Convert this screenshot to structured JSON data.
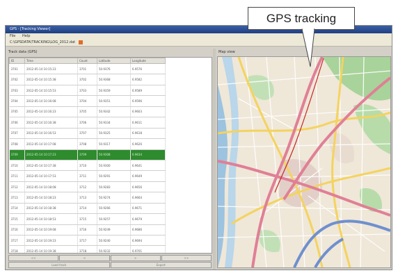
{
  "window": {
    "title": "GPS - [Tracking Viewer]"
  },
  "menu": {
    "items": [
      "File",
      "Help"
    ]
  },
  "path": {
    "text": "C:\\GPSDATA\\TRACKING\\LOG_2012.dat"
  },
  "left_panel": {
    "title": "Track data (GPS)"
  },
  "table": {
    "columns": [
      "ID",
      "Time",
      "Count",
      "Latitude",
      "Longitude"
    ],
    "rows": [
      [
        "3701",
        "2012-05-14 10:15:23",
        "3701",
        "50.9376",
        "6.9576"
      ],
      [
        "3702",
        "2012-05-14 10:15:38",
        "3702",
        "50.9368",
        "6.9582"
      ],
      [
        "3703",
        "2012-05-14 10:15:53",
        "3703",
        "50.9359",
        "6.9589"
      ],
      [
        "3704",
        "2012-05-14 10:16:08",
        "3704",
        "50.9351",
        "6.9596"
      ],
      [
        "3705",
        "2012-05-14 10:16:23",
        "3705",
        "50.9342",
        "6.9603"
      ],
      [
        "3706",
        "2012-05-14 10:16:38",
        "3706",
        "50.9334",
        "6.9611"
      ],
      [
        "3707",
        "2012-05-14 10:16:53",
        "3707",
        "50.9325",
        "6.9618"
      ],
      [
        "3708",
        "2012-05-14 10:17:08",
        "3708",
        "50.9317",
        "6.9626"
      ],
      [
        "3709",
        "2012-05-14 10:17:23",
        "3709",
        "50.9308",
        "6.9634"
      ],
      [
        "3710",
        "2012-05-14 10:17:38",
        "3710",
        "50.9300",
        "6.9641"
      ],
      [
        "3711",
        "2012-05-14 10:17:53",
        "3711",
        "50.9291",
        "6.9649"
      ],
      [
        "3712",
        "2012-05-14 10:18:08",
        "3712",
        "50.9283",
        "6.9656"
      ],
      [
        "3713",
        "2012-05-14 10:18:23",
        "3713",
        "50.9274",
        "6.9664"
      ],
      [
        "3714",
        "2012-05-14 10:18:38",
        "3714",
        "50.9266",
        "6.9671"
      ],
      [
        "3715",
        "2012-05-14 10:18:53",
        "3715",
        "50.9257",
        "6.9679"
      ],
      [
        "3716",
        "2012-05-14 10:19:08",
        "3716",
        "50.9249",
        "6.9686"
      ],
      [
        "3717",
        "2012-05-14 10:19:23",
        "3717",
        "50.9240",
        "6.9694"
      ],
      [
        "3718",
        "2012-05-14 10:19:38",
        "3718",
        "50.9232",
        "6.9701"
      ],
      [
        "3719",
        "2012-05-14 10:19:53",
        "3719",
        "50.9223",
        "6.9709"
      ]
    ],
    "selected_index": 8
  },
  "buttons_row1": [
    "<<",
    "<",
    ">",
    ">>"
  ],
  "buttons_row2": [
    "Load track",
    "Export"
  ],
  "map_panel": {
    "title": "Map view"
  },
  "callout": {
    "label": "GPS tracking"
  },
  "colors": {
    "selected_row": "#2e8b2e",
    "route": "#e07f96",
    "park": "#a8d39a",
    "water": "#9cc3e0"
  }
}
